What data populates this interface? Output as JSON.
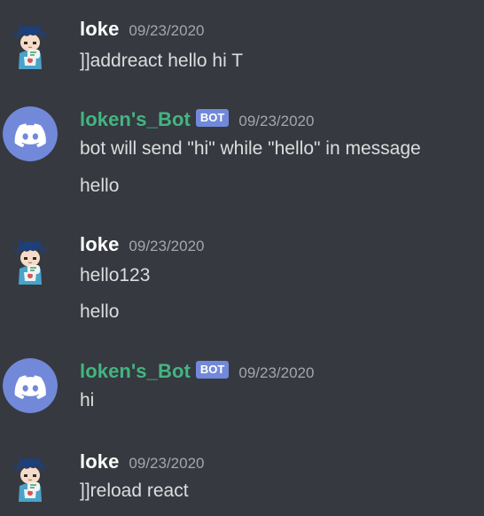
{
  "theme": {
    "background": "#36393f",
    "username_color": "#ffffff",
    "bot_username_color": "#43b581",
    "bot_tag_color": "#7289da",
    "timestamp_color": "#a3a6aa",
    "text_color": "#dcddde",
    "discord_avatar_color": "#7289da"
  },
  "messages": [
    {
      "author": "loke",
      "avatar": "anime-user-avatar",
      "timestamp": "09/23/2020",
      "lines": [
        "]]addreact hello hi T"
      ]
    },
    {
      "author": "loken's_Bot",
      "is_bot": true,
      "bot_tag": "BOT",
      "avatar": "discord-logo-avatar",
      "timestamp": "09/23/2020",
      "lines": [
        "bot will send \"hi\" while \"hello\" in message",
        "hello"
      ]
    },
    {
      "author": "loke",
      "avatar": "anime-user-avatar",
      "timestamp": "09/23/2020",
      "lines": [
        "hello123",
        "hello"
      ]
    },
    {
      "author": "loken's_Bot",
      "is_bot": true,
      "bot_tag": "BOT",
      "avatar": "discord-logo-avatar",
      "timestamp": "09/23/2020",
      "lines": [
        "hi"
      ]
    },
    {
      "author": "loke",
      "avatar": "anime-user-avatar",
      "timestamp": "09/23/2020",
      "lines": [
        "]]reload react"
      ]
    }
  ]
}
